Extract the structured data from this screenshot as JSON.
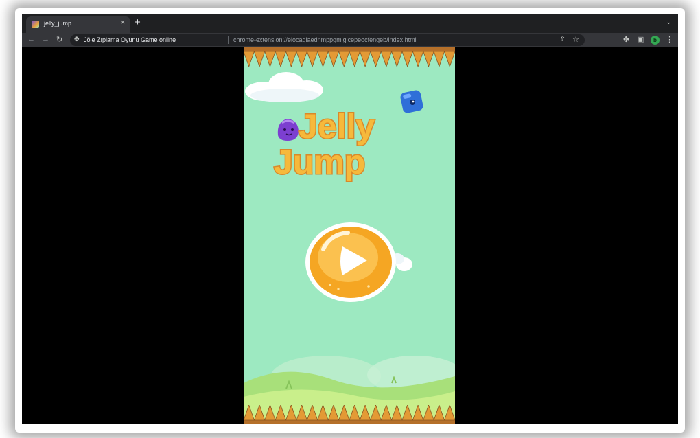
{
  "browser": {
    "tab_title": "jelly_jump",
    "tab_close": "×",
    "new_tab": "+",
    "tab_menu": "⌄",
    "site_name": "Jöle Zıplama Oyunu Game online",
    "url": "chrome-extension://eiocaglaednmppgmiglcepeocfengeb/index.html",
    "profile_initial": "b"
  },
  "game": {
    "title_line1": "Jelly",
    "title_line2": "Jump"
  },
  "colors": {
    "game_background": "#9de9c1",
    "title_fill": "#f6b93b",
    "title_outline": "#d9892a",
    "play_orange": "#f5a623",
    "spike_color": "#e39a35",
    "avatar_green": "#34a853"
  },
  "icons": {
    "back": "back-arrow-icon",
    "forward": "forward-arrow-icon",
    "reload": "reload-icon",
    "extension": "puzzle-icon",
    "share": "share-icon",
    "bookmark": "star-icon",
    "side_panel": "side-panel-icon",
    "menu": "kebab-menu-icon",
    "play": "play-icon"
  }
}
